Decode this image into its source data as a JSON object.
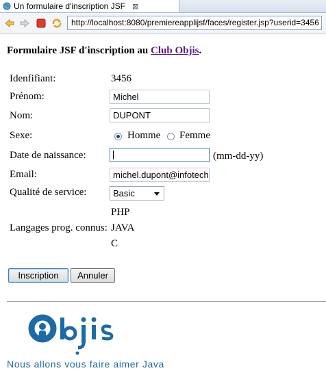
{
  "browser": {
    "tab_title": "Un formulaire d'inscription JSF",
    "tab_close": "⊠",
    "url": "http://localhost:8080/premiereapplijsf/faces/register.jsp?userid=3456"
  },
  "page": {
    "heading_prefix": "Formulaire JSF d'inscription au ",
    "heading_link": "Club Objis",
    "heading_suffix": "."
  },
  "form": {
    "id_label": "Idenfifiant:",
    "id_value": "3456",
    "firstname_label": "Prénom:",
    "firstname_value": "Michel",
    "lastname_label": "Nom:",
    "lastname_value": "DUPONT",
    "sex_label": "Sexe:",
    "sex_options": [
      "Homme",
      "Femme"
    ],
    "sex_selected": "Homme",
    "birthdate_label": "Date de naissance:",
    "birthdate_value": "",
    "birthdate_hint": "(mm-dd-yy)",
    "email_label": "Email:",
    "email_value": "michel.dupont@infotech",
    "service_label": "Qualité de service:",
    "service_value": "Basic",
    "languages_label": "Langages prog. connus:",
    "languages": [
      "PHP",
      "JAVA",
      "C"
    ]
  },
  "buttons": {
    "submit": "Inscription",
    "cancel": "Annuler"
  },
  "footer": {
    "logo_text": "Objis",
    "tagline": "Nous allons vous faire aimer Java",
    "brand_color": "#1c6aa6"
  }
}
